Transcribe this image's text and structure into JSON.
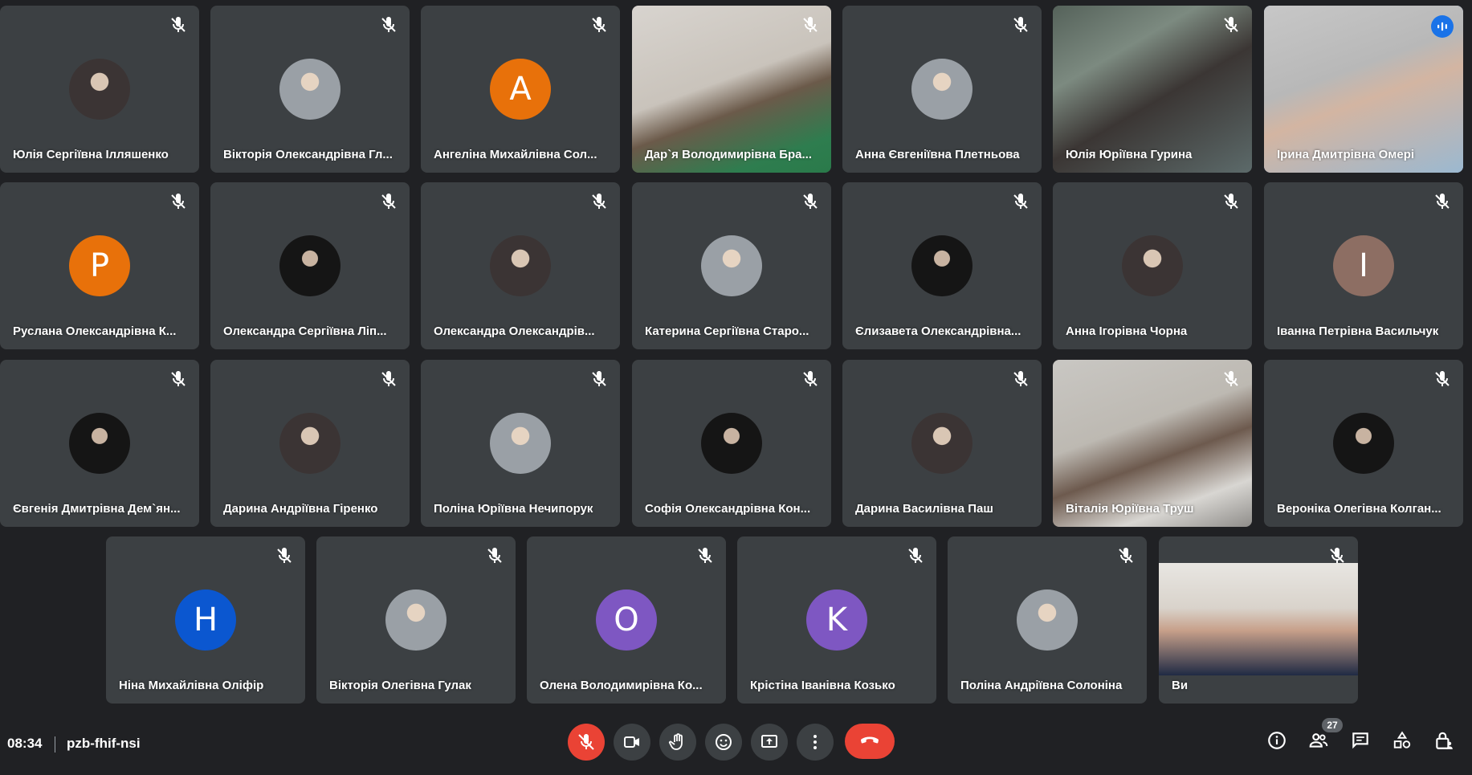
{
  "meeting": {
    "time": "08:34",
    "code": "pzb-fhif-nsi"
  },
  "participants_count": "27",
  "colors": {
    "background": "#202124",
    "tile": "#3c4043",
    "end_call": "#ea4335",
    "active_outline": "#8ab4f8",
    "speaking": "#1a73e8"
  },
  "tiles": [
    {
      "name": "Юлія Сергіївна Ілляшенко",
      "type": "photo",
      "icon": "muted-mic-icon"
    },
    {
      "name": "Вікторія Олександрівна Гл...",
      "type": "photo",
      "icon": "muted-mic-icon"
    },
    {
      "name": "Ангеліна Михайлівна Сол...",
      "type": "letter",
      "letter": "A",
      "color": "#e8710a",
      "icon": "muted-mic-icon"
    },
    {
      "name": "Дар`я Володимирівна Бра...",
      "type": "video",
      "icon": "muted-mic-icon"
    },
    {
      "name": "Анна Євгеніївна Плетньова",
      "type": "photo",
      "icon": "muted-mic-icon"
    },
    {
      "name": "Юлія Юріївна Гурина",
      "type": "video",
      "icon": "muted-mic-icon"
    },
    {
      "name": "Ірина Дмитрівна Омері",
      "type": "video",
      "icon": "speaking-icon",
      "active": true
    },
    {
      "name": "Руслана Олександрівна К...",
      "type": "letter",
      "letter": "P",
      "color": "#e8710a",
      "icon": "muted-mic-icon"
    },
    {
      "name": "Олександра Сергіївна Ліп...",
      "type": "photo",
      "icon": "muted-mic-icon"
    },
    {
      "name": "Олександра Олександрів...",
      "type": "photo",
      "icon": "muted-mic-icon"
    },
    {
      "name": "Катерина Сергіївна Старо...",
      "type": "photo",
      "icon": "muted-mic-icon"
    },
    {
      "name": "Єлизавета Олександрівна...",
      "type": "photo",
      "icon": "muted-mic-icon"
    },
    {
      "name": "Анна Ігорівна Чорна",
      "type": "photo",
      "icon": "muted-mic-icon"
    },
    {
      "name": "Іванна Петрівна Васильчук",
      "type": "letter",
      "letter": "I",
      "color": "#8d6e63",
      "icon": "muted-mic-icon"
    },
    {
      "name": "Євгенія Дмитрівна Дем`ян...",
      "type": "photo",
      "icon": "muted-mic-icon"
    },
    {
      "name": "Дарина Андріївна Гіренко",
      "type": "photo",
      "icon": "muted-mic-icon"
    },
    {
      "name": "Поліна Юріївна Нечипорук",
      "type": "photo",
      "icon": "muted-mic-icon"
    },
    {
      "name": "Софія Олександрівна Кон...",
      "type": "photo",
      "icon": "muted-mic-icon"
    },
    {
      "name": "Дарина Василівна Паш",
      "type": "photo",
      "icon": "muted-mic-icon"
    },
    {
      "name": "Віталія Юріївна Труш",
      "type": "video",
      "icon": "muted-mic-icon"
    },
    {
      "name": "Вероніка Олегівна Колган...",
      "type": "photo",
      "icon": "muted-mic-icon"
    },
    {
      "name": "Ніна Михайлівна Оліфір",
      "type": "letter",
      "letter": "H",
      "color": "#0b57d0",
      "icon": "muted-mic-icon"
    },
    {
      "name": "Вікторія Олегівна Гулак",
      "type": "photo",
      "icon": "muted-mic-icon"
    },
    {
      "name": "Олена Володимирівна Ко...",
      "type": "letter",
      "letter": "O",
      "color": "#7e57c2",
      "icon": "muted-mic-icon"
    },
    {
      "name": "Крістіна Іванівна Козько",
      "type": "letter",
      "letter": "K",
      "color": "#7e57c2",
      "icon": "muted-mic-icon"
    },
    {
      "name": "Поліна Андріївна Солоніна",
      "type": "photo",
      "icon": "muted-mic-icon"
    },
    {
      "name": "Ви",
      "type": "video",
      "icon": "muted-mic-icon"
    }
  ],
  "controls": [
    {
      "name": "mic-toggle-button",
      "icon": "mic-off-icon"
    },
    {
      "name": "camera-toggle-button",
      "icon": "videocam-icon"
    },
    {
      "name": "raise-hand-button",
      "icon": "hand-icon"
    },
    {
      "name": "reactions-button",
      "icon": "emoji-icon"
    },
    {
      "name": "present-screen-button",
      "icon": "present-icon"
    },
    {
      "name": "more-options-button",
      "icon": "more-vert-icon"
    },
    {
      "name": "end-call-button",
      "icon": "call-end-icon"
    }
  ],
  "right_controls": [
    {
      "name": "meeting-details-button",
      "icon": "info-icon"
    },
    {
      "name": "people-button",
      "icon": "people-icon"
    },
    {
      "name": "chat-button",
      "icon": "chat-icon"
    },
    {
      "name": "activities-button",
      "icon": "activities-icon"
    },
    {
      "name": "host-controls-button",
      "icon": "lock-person-icon"
    }
  ]
}
